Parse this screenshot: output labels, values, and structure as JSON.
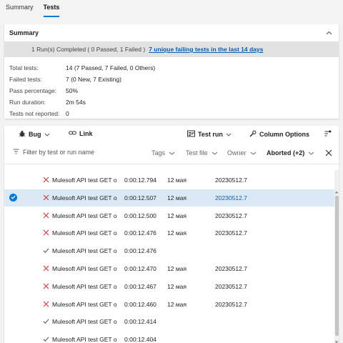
{
  "tabs": [
    {
      "label": "Summary"
    },
    {
      "label": "Tests"
    }
  ],
  "summary": {
    "title": "Summary",
    "banner_text": "1 Run(s) Completed ( 0 Passed, 1 Failed )",
    "banner_link": "7 unique failing tests in the last 14 days",
    "stats": [
      {
        "label": "Total tests:",
        "value": "14 (7 Passed, 7 Failed, 0 Others)"
      },
      {
        "label": "Failed tests:",
        "value": "7 (0 New, 7 Existing)"
      },
      {
        "label": "Pass percentage:",
        "value": "50%"
      },
      {
        "label": "Run duration:",
        "value": "2m 54s"
      },
      {
        "label": "Tests not reported:",
        "value": "0"
      }
    ]
  },
  "toolbar": {
    "bug_label": "Bug",
    "link_label": "Link",
    "test_run_label": "Test run",
    "column_options_label": "Column Options"
  },
  "filters": {
    "placeholder": "Filter by test or run name",
    "tags": "Tags",
    "test_file": "Test file",
    "owner": "Owner",
    "outcome": "Aborted (+2)"
  },
  "colors": {
    "accent": "#0078d4",
    "failed": "#d13438",
    "passed": "#5a5a5a",
    "selected_row": "#dbe9f7"
  },
  "rows": [
    {
      "status": "failed",
      "name": "Mulesoft API test GET o",
      "duration": "0:00:12.794",
      "date": "12 мая",
      "version": "20230512.7"
    },
    {
      "status": "failed",
      "name": "Mulesoft API test GET o",
      "duration": "0:00:12.507",
      "date": "12 мая",
      "version": "20230512.7"
    },
    {
      "status": "failed",
      "name": "Mulesoft API test GET o",
      "duration": "0:00:12.500",
      "date": "12 мая",
      "version": "20230512.7"
    },
    {
      "status": "failed",
      "name": "Mulesoft API test GET o",
      "duration": "0:00:12.476",
      "date": "12 мая",
      "version": "20230512.7"
    },
    {
      "status": "passed",
      "name": "Mulesoft API test GET o",
      "duration": "0:00:12.476",
      "date": "",
      "version": ""
    },
    {
      "status": "failed",
      "name": "Mulesoft API test GET o",
      "duration": "0:00:12.470",
      "date": "12 мая",
      "version": "20230512.7"
    },
    {
      "status": "failed",
      "name": "Mulesoft API test GET o",
      "duration": "0:00:12.467",
      "date": "12 мая",
      "version": "20230512.7"
    },
    {
      "status": "failed",
      "name": "Mulesoft API test GET o",
      "duration": "0:00:12.460",
      "date": "12 мая",
      "version": "20230512.7"
    },
    {
      "status": "passed",
      "name": "Mulesoft API test GET o",
      "duration": "0:00:12.414",
      "date": "",
      "version": ""
    },
    {
      "status": "passed",
      "name": "Mulesoft API test GET o",
      "duration": "0:00:12.404",
      "date": "",
      "version": ""
    }
  ],
  "selected_row": 1
}
